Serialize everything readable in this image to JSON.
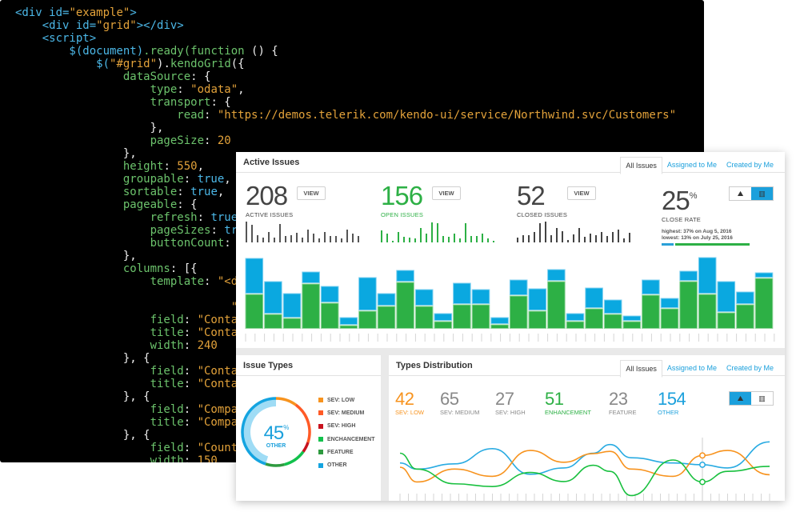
{
  "code": {
    "lines": [
      [
        [
          "<div ",
          "t-tag"
        ],
        [
          "id=",
          "t-tag"
        ],
        [
          "\"example\"",
          "t-str"
        ],
        [
          ">",
          "t-tag"
        ]
      ],
      [
        [
          "    <div ",
          "t-tag"
        ],
        [
          "id=",
          "t-tag"
        ],
        [
          "\"grid\"",
          "t-str"
        ],
        [
          "></div>",
          "t-tag"
        ]
      ],
      [
        [
          "    <script>",
          "t-tag"
        ]
      ],
      [
        [
          "        $(document)",
          "t-kw"
        ],
        [
          ".ready(function ",
          "t-fn"
        ],
        [
          "() {",
          "t-p"
        ]
      ],
      [
        [
          "            $(",
          "t-kw"
        ],
        [
          "\"#grid\"",
          "t-str"
        ],
        [
          ").",
          "t-p"
        ],
        [
          "kendoGrid",
          "t-fn"
        ],
        [
          "({",
          "t-p"
        ]
      ],
      [
        [
          "                dataSource",
          "t-key"
        ],
        [
          ": {",
          "t-p"
        ]
      ],
      [
        [
          "                    type",
          "t-key"
        ],
        [
          ": ",
          "t-p"
        ],
        [
          "\"odata\"",
          "t-str"
        ],
        [
          ",",
          "t-p"
        ]
      ],
      [
        [
          "                    transport",
          "t-key"
        ],
        [
          ": {",
          "t-p"
        ]
      ],
      [
        [
          "                        read",
          "t-key"
        ],
        [
          ": ",
          "t-p"
        ],
        [
          "\"https://demos.telerik.com/kendo-ui/service/Northwind.svc/Customers\"",
          "t-str"
        ]
      ],
      [
        [
          "                    },",
          "t-p"
        ]
      ],
      [
        [
          "                    pageSize",
          "t-key"
        ],
        [
          ": ",
          "t-p"
        ],
        [
          "20",
          "t-num"
        ]
      ],
      [
        [
          "                },",
          "t-p"
        ]
      ],
      [
        [
          "                height",
          "t-key"
        ],
        [
          ": ",
          "t-p"
        ],
        [
          "550",
          "t-num"
        ],
        [
          ",",
          "t-p"
        ]
      ],
      [
        [
          "                groupable",
          "t-key"
        ],
        [
          ": ",
          "t-p"
        ],
        [
          "true",
          "t-kw"
        ],
        [
          ",",
          "t-p"
        ]
      ],
      [
        [
          "                sortable",
          "t-key"
        ],
        [
          ": ",
          "t-p"
        ],
        [
          "true",
          "t-kw"
        ],
        [
          ",",
          "t-p"
        ]
      ],
      [
        [
          "                pageable",
          "t-key"
        ],
        [
          ": {",
          "t-p"
        ]
      ],
      [
        [
          "                    refresh",
          "t-key"
        ],
        [
          ": ",
          "t-p"
        ],
        [
          "true",
          "t-kw"
        ]
      ],
      [
        [
          "                    pageSizes",
          "t-key"
        ],
        [
          ": ",
          "t-p"
        ],
        [
          "tr",
          "t-kw"
        ]
      ],
      [
        [
          "                    buttonCount",
          "t-key"
        ],
        [
          ":",
          "t-p"
        ]
      ],
      [
        [
          "                },",
          "t-p"
        ]
      ],
      [
        [
          "                columns",
          "t-key"
        ],
        [
          ": [{",
          "t-p"
        ]
      ],
      [
        [
          "                    template",
          "t-key"
        ],
        [
          ": ",
          "t-p"
        ],
        [
          "\"<d",
          "t-str"
        ]
      ],
      [
        [
          "",
          "t-p"
        ]
      ],
      [
        [
          "                                \"",
          "t-str"
        ]
      ],
      [
        [
          "                    field",
          "t-key"
        ],
        [
          ": ",
          "t-p"
        ],
        [
          "\"Conta",
          "t-str"
        ]
      ],
      [
        [
          "                    title",
          "t-key"
        ],
        [
          ": ",
          "t-p"
        ],
        [
          "\"Conta",
          "t-str"
        ]
      ],
      [
        [
          "                    width",
          "t-key"
        ],
        [
          ": ",
          "t-p"
        ],
        [
          "240",
          "t-num"
        ]
      ],
      [
        [
          "                }, {",
          "t-p"
        ]
      ],
      [
        [
          "                    field",
          "t-key"
        ],
        [
          ": ",
          "t-p"
        ],
        [
          "\"Conta",
          "t-str"
        ]
      ],
      [
        [
          "                    title",
          "t-key"
        ],
        [
          ": ",
          "t-p"
        ],
        [
          "\"Conta",
          "t-str"
        ]
      ],
      [
        [
          "                }, {",
          "t-p"
        ]
      ],
      [
        [
          "                    field",
          "t-key"
        ],
        [
          ": ",
          "t-p"
        ],
        [
          "\"Compa",
          "t-str"
        ]
      ],
      [
        [
          "                    title",
          "t-key"
        ],
        [
          ": ",
          "t-p"
        ],
        [
          "\"Compa",
          "t-str"
        ]
      ],
      [
        [
          "                }, {",
          "t-p"
        ]
      ],
      [
        [
          "                    field",
          "t-key"
        ],
        [
          ": ",
          "t-p"
        ],
        [
          "\"Count",
          "t-str"
        ]
      ],
      [
        [
          "                    width",
          "t-key"
        ],
        [
          ": ",
          "t-p"
        ],
        [
          "150",
          "t-num"
        ]
      ]
    ]
  },
  "colors": {
    "green": "#2db045",
    "blue": "#0aa8e0",
    "orange": "#f7931e",
    "gray": "#555555",
    "accent": "#1ba0dc"
  },
  "active_issues": {
    "title": "Active Issues",
    "tabs": [
      {
        "label": "All Issues",
        "active": true
      },
      {
        "label": "Assigned to Me",
        "active": false
      },
      {
        "label": "Created by Me",
        "active": false
      }
    ],
    "stats": [
      {
        "value": "208",
        "label": "ACTIVE ISSUES",
        "button": "VIEW",
        "color": "#444444",
        "spark": [
          26,
          22,
          9,
          6,
          13,
          6,
          23,
          8,
          9,
          12,
          6,
          16,
          11,
          5,
          13,
          8,
          8,
          5,
          16,
          11,
          8
        ]
      },
      {
        "value": "156",
        "label": "OPEN ISSUES",
        "button": "VIEW",
        "color": "#2db045",
        "spark": [
          15,
          11,
          2,
          13,
          7,
          6,
          5,
          18,
          11,
          25,
          24,
          8,
          7,
          11,
          5,
          24,
          8,
          8,
          11,
          5,
          2
        ]
      },
      {
        "value": "52",
        "label": "CLOSED ISSUES",
        "button": "VIEW",
        "color": "#444444",
        "spark": [
          6,
          9,
          9,
          13,
          24,
          26,
          9,
          18,
          14,
          3,
          10,
          18,
          7,
          11,
          9,
          13,
          8,
          13,
          16,
          5,
          12
        ]
      }
    ],
    "close_rate": {
      "value": "25",
      "unit": "%",
      "label": "CLOSE RATE",
      "highest": "highest: 37% on Aug 5, 2016",
      "lowest": "lowest: 13% on July 25, 2016",
      "progress_percent": 25,
      "toggle": [
        {
          "icon": "area-chart-icon",
          "active": false
        },
        {
          "icon": "bar-chart-icon",
          "active": true
        }
      ]
    }
  },
  "chart_data": [
    {
      "type": "bar",
      "stacked": true,
      "series": [
        {
          "color": "#2db045",
          "values": [
            44,
            19,
            14,
            57,
            33,
            5,
            23,
            29,
            59,
            29,
            10,
            31,
            31,
            6,
            42,
            23,
            60,
            10,
            26,
            19,
            10,
            43,
            26,
            60,
            44,
            21,
            31,
            64
          ]
        },
        {
          "color": "#0aa8e0",
          "values": [
            45,
            41,
            31,
            15,
            21,
            10,
            42,
            16,
            15,
            21,
            10,
            27,
            19,
            9,
            20,
            28,
            15,
            10,
            26,
            18,
            7,
            19,
            13,
            13,
            46,
            39,
            16,
            7
          ]
        }
      ],
      "grid": false
    },
    {
      "type": "line",
      "x": [
        0,
        2,
        6.5,
        11,
        15.5,
        19.5,
        23,
        25,
        27.5,
        32.5,
        36,
        39,
        44
      ],
      "xlim": [
        0,
        44
      ],
      "ylim": [
        0,
        300
      ],
      "marker_x": 36,
      "series": [
        {
          "color": "#29abe2",
          "values": [
            167,
            140,
            163,
            230,
            117,
            145,
            210,
            248,
            190,
            167,
            159,
            145,
            260
          ]
        },
        {
          "color": "#f7931e",
          "values": [
            148,
            83,
            140,
            108,
            222,
            170,
            208,
            218,
            140,
            108,
            200,
            222,
            115
          ]
        },
        {
          "color": "#19c03f",
          "values": [
            210,
            140,
            75,
            63,
            125,
            85,
            157,
            130,
            23,
            180,
            83,
            130,
            152
          ]
        }
      ],
      "grid": false
    },
    {
      "type": "pie",
      "donut": true,
      "center_value": "45",
      "center_unit": "%",
      "center_label": "OTHER",
      "slices": [
        {
          "name": "SEV: LOW",
          "value": 10,
          "color": "#f7931e"
        },
        {
          "name": "SEV: MEDIUM",
          "value": 20,
          "color": "#ff5a26"
        },
        {
          "name": "SEV: HIGH",
          "value": 5,
          "color": "#c8121e"
        },
        {
          "name": "ENCHANCEMENT",
          "value": 11,
          "color": "#12c14c"
        },
        {
          "name": "FEATURE",
          "value": 9,
          "color": "#2e9a3f"
        },
        {
          "name": "OTHER",
          "value": 45,
          "color": "#14a4e0"
        }
      ]
    }
  ],
  "issue_types": {
    "title": "Issue Types"
  },
  "types_distribution": {
    "title": "Types Distribution",
    "tabs": [
      {
        "label": "All Issues",
        "active": true
      },
      {
        "label": "Assigned to Me",
        "active": false
      },
      {
        "label": "Created by Me",
        "active": false
      }
    ],
    "stats": [
      {
        "value": "42",
        "label": "SEV: LOW",
        "color": "#f7931e"
      },
      {
        "value": "65",
        "label": "SEV: MEDIUM",
        "color": "#888888"
      },
      {
        "value": "27",
        "label": "SEV: HIGH",
        "color": "#888888"
      },
      {
        "value": "51",
        "label": "ENHANCEMENT",
        "color": "#2db045"
      },
      {
        "value": "23",
        "label": "FEATURE",
        "color": "#888888"
      },
      {
        "value": "154",
        "label": "OTHER",
        "color": "#1ba0dc"
      }
    ],
    "toggle": [
      {
        "icon": "area-chart-icon",
        "active": true
      },
      {
        "icon": "bar-chart-icon",
        "active": false
      }
    ]
  }
}
